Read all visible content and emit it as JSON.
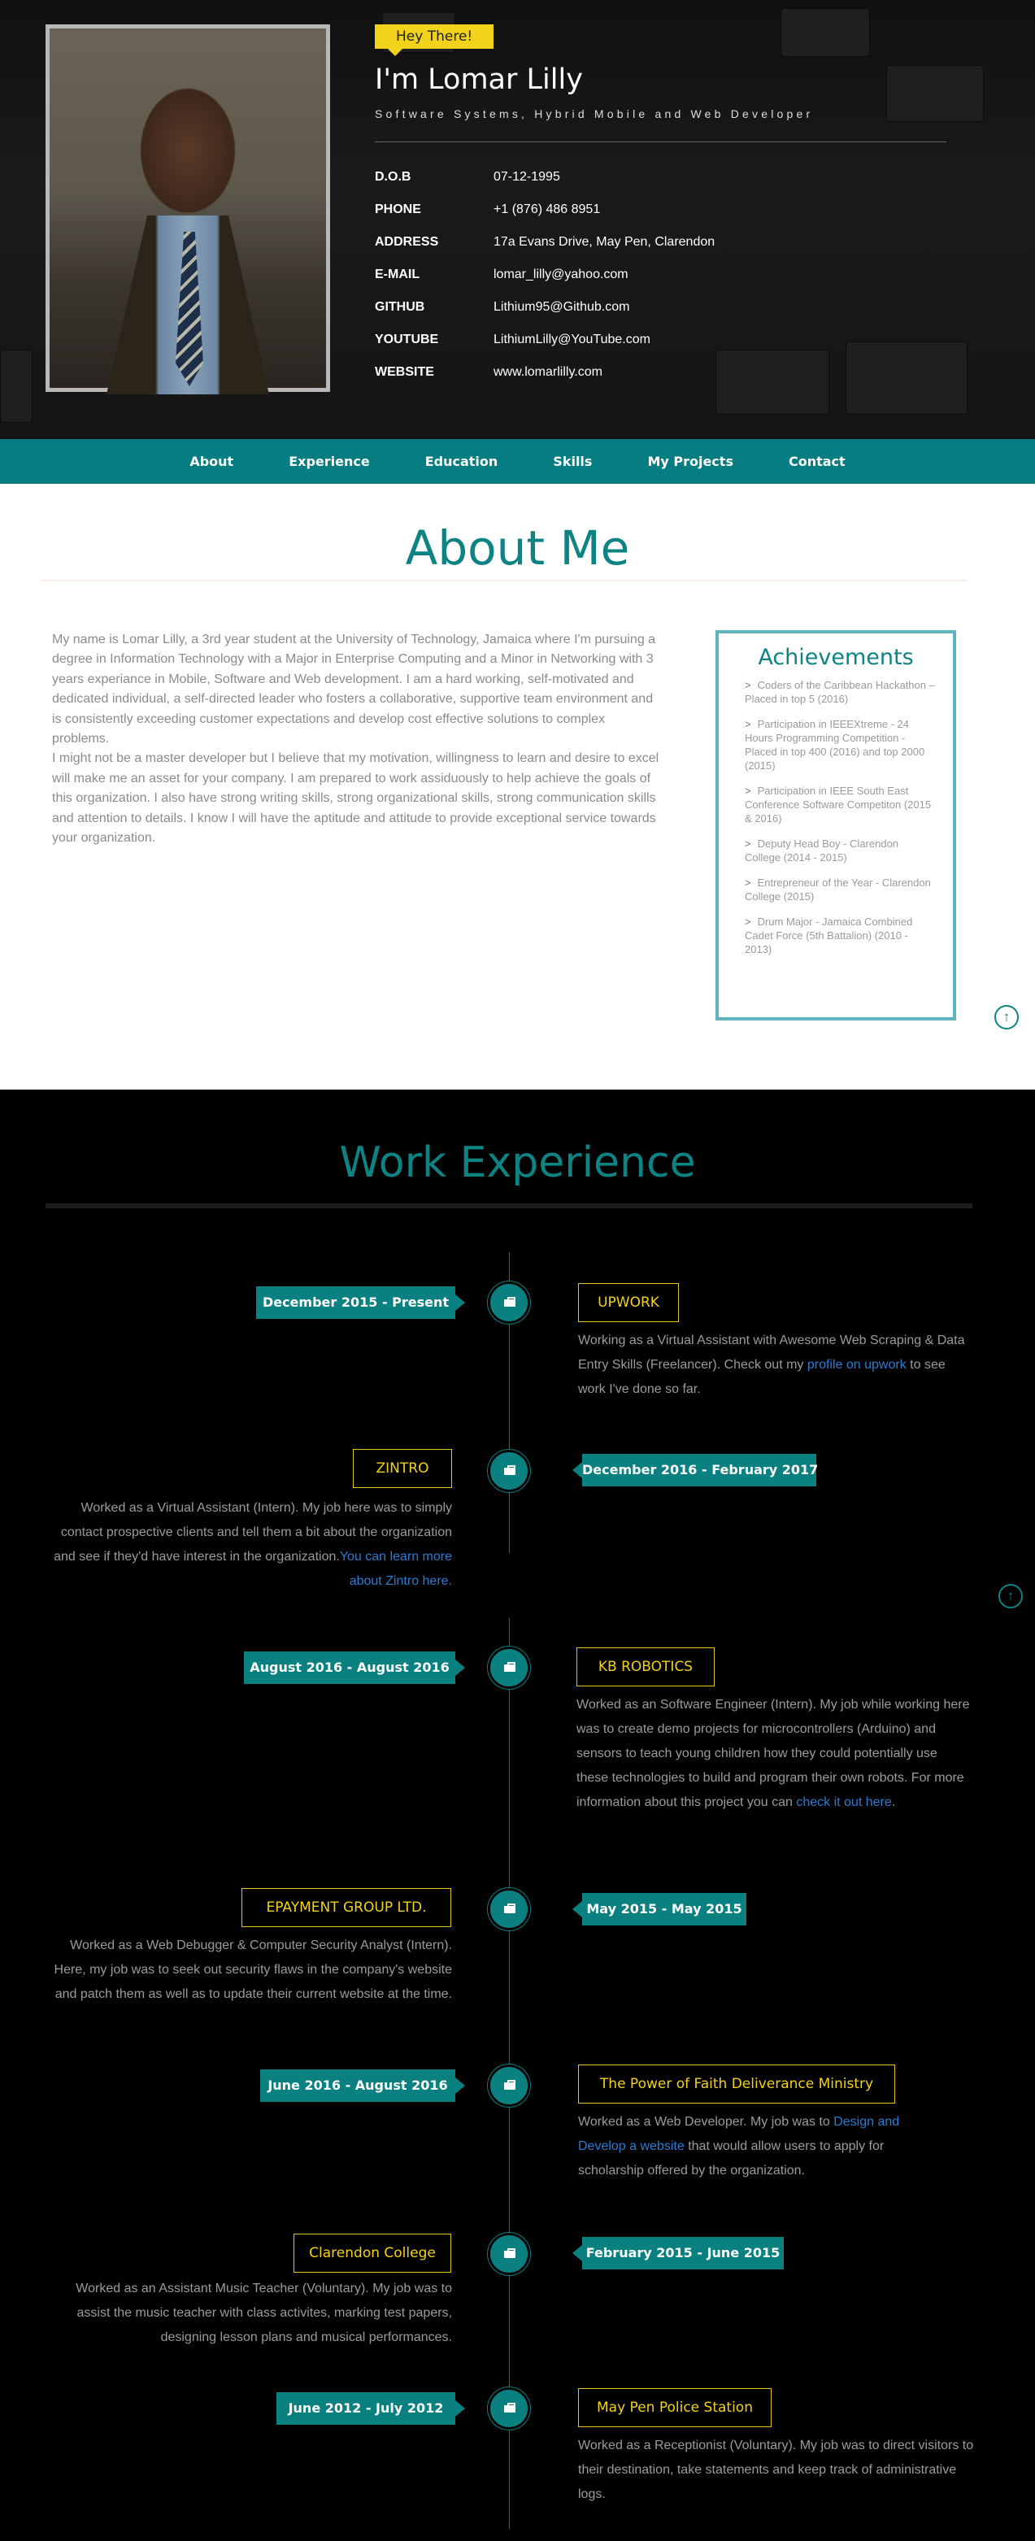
{
  "header": {
    "greeting": "Hey There!",
    "name": "I'm Lomar Lilly",
    "tagline": "Software Systems, Hybrid Mobile and Web Developer",
    "info": [
      {
        "label": "D.O.B",
        "value": "07-12-1995"
      },
      {
        "label": "PHONE",
        "value": "+1 (876) 486 8951"
      },
      {
        "label": "ADDRESS",
        "value": "17a Evans Drive, May Pen, Clarendon"
      },
      {
        "label": "E-MAIL",
        "value": "lomar_lilly@yahoo.com"
      },
      {
        "label": "GITHUB",
        "value": "Lithium95@Github.com"
      },
      {
        "label": "YOUTUBE",
        "value": "LithiumLilly@YouTube.com"
      },
      {
        "label": "WEBSITE",
        "value": "www.lomarlilly.com"
      }
    ]
  },
  "nav": [
    "About",
    "Experience",
    "Education",
    "Skills",
    "My Projects",
    "Contact"
  ],
  "about": {
    "title": "About Me",
    "paragraph1": "My name is Lomar Lilly, a 3rd year student at the University of Technology, Jamaica where I'm pursuing a degree in Information Technology with a Major in Enterprise Computing and a Minor in Networking with 3 years experiance in Mobile, Software and Web development. I am a hard working, self-motivated and dedicated individual, a self-directed leader who fosters a collaborative, supportive team environment and is consistently exceeding customer expectations and develop cost effective solutions to complex problems.",
    "paragraph2": "I might not be a master developer but I believe that my motivation, willingness to learn and desire to excel will make me an asset for your company. I am prepared to work assiduously to help achieve the goals of this organization. I also have strong writing skills, strong organizational skills, strong communication skills and attention to details. I know I will have the aptitude and attitude to provide exceptional service towards your organization.",
    "achievements_title": "Achievements",
    "achievements": [
      "Coders of the Caribbean Hackathon – Placed in top 5 (2016)",
      "Participation in IEEEXtreme - 24 Hours Programming Competition - Placed in top 400 (2016) and top 2000 (2015)",
      "Participation in IEEE South East Conference Software Competiton (2015 & 2016)",
      "Deputy Head Boy - Clarendon College (2014 - 2015)",
      "Entrepreneur of the Year - Clarendon College (2015)",
      "Drum Major - Jamaica Combined Cadet Force (5th Battalion) (2010 - 2013)"
    ]
  },
  "work": {
    "title": "Work Experience",
    "jobs": [
      {
        "date": "December 2015 - Present",
        "company": "UPWORK",
        "desc": "Working as a Virtual Assistant with Awesome Web Scraping & Data Entry Skills (Freelancer). Check out my ",
        "link": "profile on upwork",
        "after": " to see work I've done so far."
      },
      {
        "date": "December 2016 - February 2017",
        "company": "ZINTRO",
        "desc": "Worked as a Virtual Assistant (Intern). My job here was to simply contact prospective clients and tell them a bit about the organization and see if they'd have interest in the organization.",
        "link": "You can learn more about Zintro here.",
        "after": ""
      },
      {
        "date": "August 2016 - August 2016",
        "company": "KB ROBOTICS",
        "desc": "Worked as an Software Engineer (Intern). My job while working here was to create demo projects for microcontrollers (Arduino) and sensors to teach young children how they could potentially use these technologies to build and program their own robots. For more information about this project you can ",
        "link": "check it out here",
        "after": "."
      },
      {
        "date": "May 2015 - May 2015",
        "company": "EPAYMENT GROUP LTD.",
        "desc": "Worked as a Web Debugger & Computer Security Analyst (Intern). Here, my job was to seek out security flaws in the company's website and patch them as well as to update their current website at the time.",
        "link": "",
        "after": ""
      },
      {
        "date": "June 2016 - August 2016",
        "company": "The Power of Faith Deliverance Ministry",
        "desc": "Worked as a Web Developer. My job was to ",
        "link": "Design and Develop a website",
        "after": " that would allow users to apply for scholarship offered by the organization."
      },
      {
        "date": "February 2015 - June 2015",
        "company": "Clarendon College",
        "desc": "Worked as an Assistant Music Teacher (Voluntary). My job was to assist the music teacher with class activites, marking test papers, designing lesson plans and musical performances.",
        "link": "",
        "after": ""
      },
      {
        "date": "June 2012 - July 2012",
        "company": "May Pen Police Station",
        "desc": "Worked as a Receptionist (Voluntary). My job was to direct visitors to their destination, take statements and keep track of administrative logs.",
        "link": "",
        "after": ""
      }
    ]
  },
  "colors": {
    "teal": "#0a8080",
    "gold": "#f2d21b",
    "link": "#2b7bd0"
  },
  "icons": {
    "back_to_top": "arrow-up-circle-icon",
    "timeline": "briefcase-icon",
    "achievement_bullet": "chevron-right-icon"
  }
}
